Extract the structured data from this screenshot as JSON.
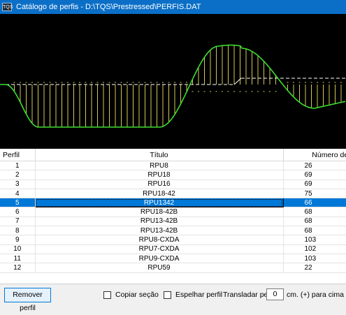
{
  "window": {
    "icon_text": "TQS",
    "title": "Catálogo de perfis - D:\\TQS\\Prestressed\\PERFIS.DAT"
  },
  "preview": {
    "background": "#000000",
    "curve_color": "#3ddc2f",
    "hatch_color": "#d4c85a",
    "axis_color": "#ffffff"
  },
  "table": {
    "columns": [
      "Perfil",
      "Título",
      "Número de pon"
    ],
    "rows": [
      {
        "perfil": "1",
        "titulo": "RPU8",
        "pontos": "26"
      },
      {
        "perfil": "2",
        "titulo": "RPU18",
        "pontos": "69"
      },
      {
        "perfil": "3",
        "titulo": "RPU16",
        "pontos": "69"
      },
      {
        "perfil": "4",
        "titulo": "RPU18-42",
        "pontos": "75"
      },
      {
        "perfil": "5",
        "titulo": "RPU1342",
        "pontos": "66"
      },
      {
        "perfil": "6",
        "titulo": "RPU18-42B",
        "pontos": "68"
      },
      {
        "perfil": "7",
        "titulo": "RPU13-42B",
        "pontos": "68"
      },
      {
        "perfil": "8",
        "titulo": "RPU13-42B",
        "pontos": "68"
      },
      {
        "perfil": "9",
        "titulo": "RPU8-CXDA",
        "pontos": "103"
      },
      {
        "perfil": "10",
        "titulo": "RPU7-CXDA",
        "pontos": "102"
      },
      {
        "perfil": "11",
        "titulo": "RPU9-CXDA",
        "pontos": "103"
      },
      {
        "perfil": "12",
        "titulo": "RPU59",
        "pontos": "22"
      }
    ],
    "selected_index": 4
  },
  "footer": {
    "remove_label": "Remover perfil",
    "copy_label": "Copiar seção",
    "mirror_label": "Espelhar perfil",
    "translate_label": "Transladar perfil:",
    "translate_value": "0",
    "unit_label": "cm. (+) para cima"
  }
}
